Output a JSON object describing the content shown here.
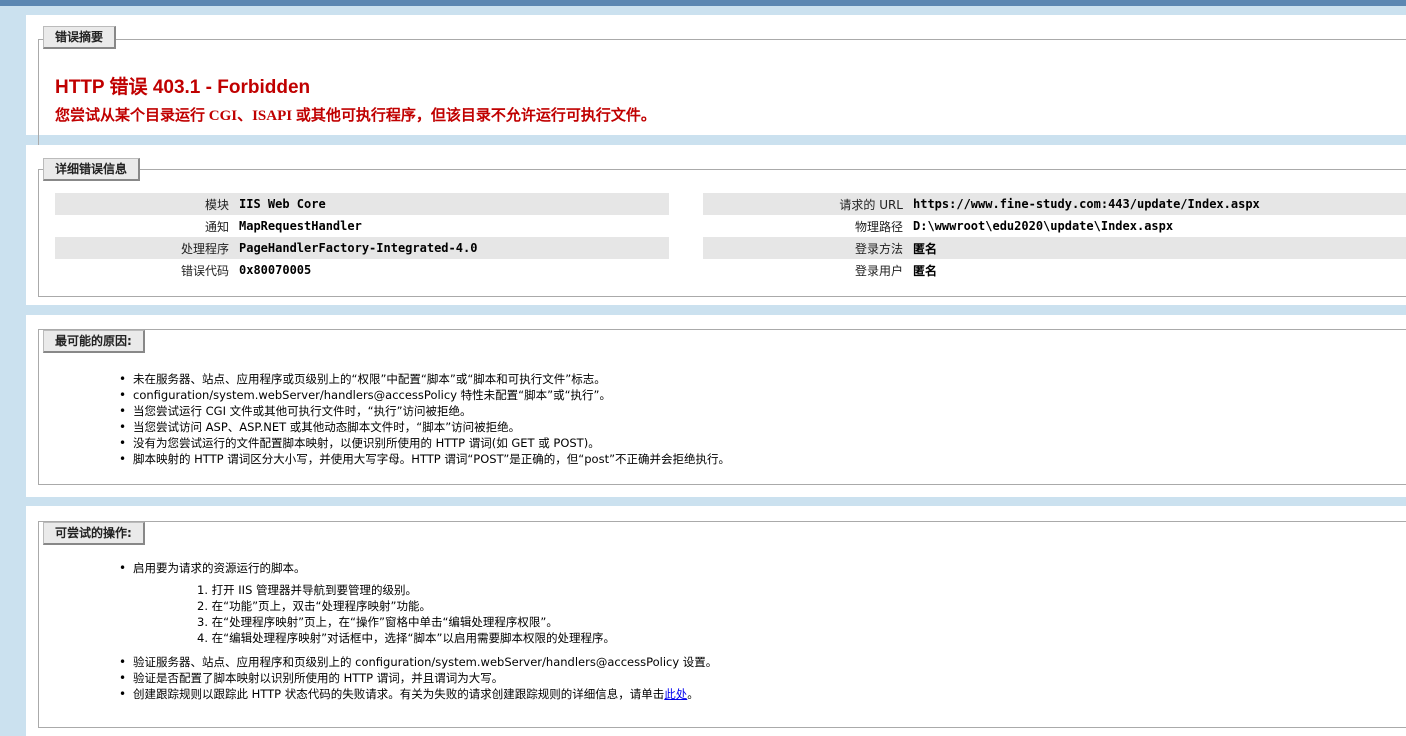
{
  "summary": {
    "legend": "错误摘要",
    "title": "HTTP 错误 403.1 - Forbidden",
    "message": "您尝试从某个目录运行 CGI、ISAPI 或其他可执行程序，但该目录不允许运行可执行文件。"
  },
  "details": {
    "legend": "详细错误信息",
    "left": [
      {
        "key": "模块",
        "value": "IIS Web Core"
      },
      {
        "key": "通知",
        "value": "MapRequestHandler"
      },
      {
        "key": "处理程序",
        "value": "PageHandlerFactory-Integrated-4.0"
      },
      {
        "key": "错误代码",
        "value": "0x80070005"
      }
    ],
    "right": [
      {
        "key": "请求的 URL",
        "value": "https://www.fine-study.com:443/update/Index.aspx"
      },
      {
        "key": "物理路径",
        "value": "D:\\wwwroot\\edu2020\\update\\Index.aspx"
      },
      {
        "key": "登录方法",
        "value": "匿名"
      },
      {
        "key": "登录用户",
        "value": "匿名"
      }
    ]
  },
  "causes": {
    "legend": "最可能的原因:",
    "items": [
      "未在服务器、站点、应用程序或页级别上的“权限”中配置“脚本”或“脚本和可执行文件”标志。",
      "configuration/system.webServer/handlers@accessPolicy 特性未配置“脚本”或“执行”。",
      "当您尝试运行 CGI 文件或其他可执行文件时，“执行”访问被拒绝。",
      "当您尝试访问 ASP、ASP.NET 或其他动态脚本文件时，“脚本”访问被拒绝。",
      "没有为您尝试运行的文件配置脚本映射，以便识别所使用的 HTTP 谓词(如 GET 或 POST)。",
      "脚本映射的 HTTP 谓词区分大小写，并使用大写字母。HTTP 谓词“POST”是正确的，但“post”不正确并会拒绝执行。"
    ]
  },
  "actions": {
    "legend": "可尝试的操作:",
    "first": "启用要为请求的资源运行的脚本。",
    "steps": [
      "1. 打开 IIS 管理器并导航到要管理的级别。",
      "2. 在“功能”页上，双击“处理程序映射”功能。",
      "3. 在“处理程序映射”页上，在“操作”窗格中单击“编辑处理程序权限”。",
      "4. 在“编辑处理程序映射”对话框中，选择“脚本”以启用需要脚本权限的处理程序。"
    ],
    "verify1": "验证服务器、站点、应用程序和页级别上的 configuration/system.webServer/handlers@accessPolicy 设置。",
    "verify2": "验证是否配置了脚本映射以识别所使用的 HTTP 谓词，并且谓词为大写。",
    "trace_prefix": "创建跟踪规则以跟踪此 HTTP 状态代码的失败请求。有关为失败的请求创建跟踪规则的详细信息，请单击",
    "trace_link": "此处",
    "trace_suffix": "。"
  }
}
